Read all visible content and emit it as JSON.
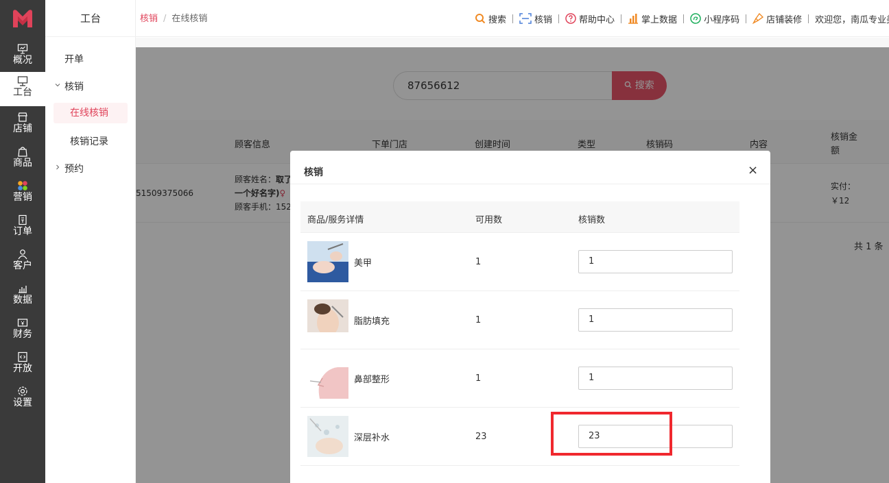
{
  "rail": {
    "items": [
      {
        "label": "概况",
        "icon": "monitor-chart-icon"
      },
      {
        "label": "工台",
        "icon": "desktop-icon"
      },
      {
        "label": "店铺",
        "icon": "store-icon"
      },
      {
        "label": "商品",
        "icon": "bag-icon"
      },
      {
        "label": "营销",
        "icon": "flower-icon"
      },
      {
        "label": "订单",
        "icon": "order-icon"
      },
      {
        "label": "客户",
        "icon": "user-icon"
      },
      {
        "label": "数据",
        "icon": "data-chart-icon"
      },
      {
        "label": "财务",
        "icon": "finance-icon"
      },
      {
        "label": "开放",
        "icon": "code-icon"
      },
      {
        "label": "设置",
        "icon": "gear-icon"
      }
    ],
    "active_index": 1
  },
  "submenu": {
    "title": "工台",
    "items": {
      "kaidan": "开单",
      "hexiao": "核销",
      "online": "在线核销",
      "record": "核销记录",
      "yuyue": "预约"
    }
  },
  "header": {
    "breadcrumb": {
      "first": "核销",
      "sep": "/",
      "second": "在线核销"
    },
    "nav": {
      "search": "搜索",
      "verify": "核销",
      "help": "帮助中心",
      "data": "掌上数据",
      "mini": "小程序码",
      "decor": "店铺装修",
      "welcome": "欢迎您，南瓜专业美容"
    }
  },
  "search": {
    "value": "87656612",
    "button": "搜索"
  },
  "table": {
    "headers": {
      "customer": "顾客信息",
      "store": "下单门店",
      "created": "创建时间",
      "type": "类型",
      "code": "核销码",
      "content": "内容",
      "amount_line1": "核销金",
      "amount_line2": "额"
    },
    "row": {
      "order_no": "51509375066",
      "name_label": "顾客姓名：",
      "name_value": "取了",
      "name_line2": "一个好名字)",
      "gender": "♀",
      "phone_label": "顾客手机：",
      "phone_value": "152",
      "paid_label": "实付：",
      "paid_value": "￥12"
    },
    "total": "共 1 条"
  },
  "modal": {
    "title": "核销",
    "close": "×",
    "headers": {
      "product": "商品/服务详情",
      "available": "可用数",
      "verify": "核销数"
    },
    "rows": [
      {
        "name": "美甲",
        "available": "1",
        "verify": "1"
      },
      {
        "name": "脂肪填充",
        "available": "1",
        "verify": "1"
      },
      {
        "name": "鼻部整形",
        "available": "1",
        "verify": "1"
      },
      {
        "name": "深层补水",
        "available": "23",
        "verify": "23"
      }
    ]
  },
  "colors": {
    "accent": "#e0435a",
    "highlight": "#f0282e",
    "rail": "#3a3a3a"
  }
}
